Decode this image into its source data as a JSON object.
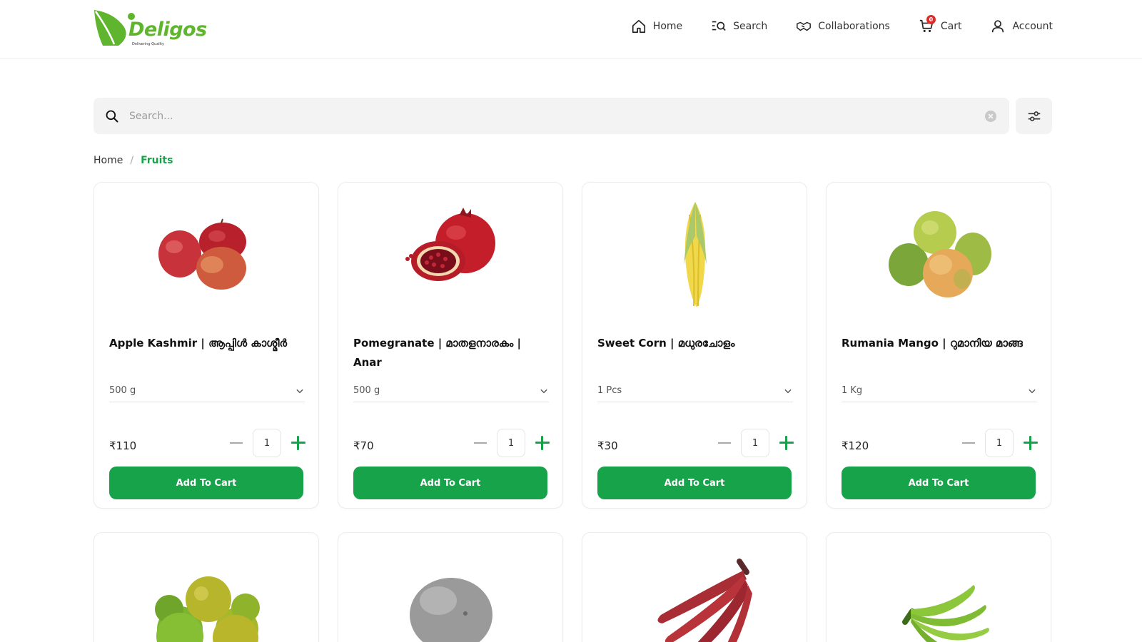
{
  "brand": {
    "name": "Deligos",
    "tagline": "Delivering Quality",
    "color": "#5fb52d"
  },
  "nav": {
    "home": "Home",
    "search": "Search",
    "collaborations": "Collaborations",
    "cart": "Cart",
    "cart_count": "0",
    "account": "Account"
  },
  "search": {
    "placeholder": "Search..."
  },
  "breadcrumb": {
    "home": "Home",
    "separator": "/",
    "current": "Fruits"
  },
  "accent_color": "#16a34a",
  "products": [
    {
      "name": "Apple Kashmir | ആപ്പിൾ കാശ്മീർ",
      "variant": "500 g",
      "price": "₹110",
      "qty": "1",
      "button": "Add To Cart"
    },
    {
      "name": "Pomegranate | മാതളനാരകം | Anar",
      "variant": "500 g",
      "price": "₹70",
      "qty": "1",
      "button": "Add To Cart"
    },
    {
      "name": "Sweet Corn | മധുരചോളം",
      "variant": "1 Pcs",
      "price": "₹30",
      "qty": "1",
      "button": "Add To Cart"
    },
    {
      "name": "Rumania Mango | റുമാനിയ മാങ്ങ",
      "variant": "1 Kg",
      "price": "₹120",
      "qty": "1",
      "button": "Add To Cart"
    }
  ],
  "product_images": [
    "apple-image",
    "pomegranate-image",
    "sweet-corn-image",
    "mango-image",
    "orange-image",
    "coconut-image",
    "red-banana-image",
    "green-banana-image"
  ]
}
